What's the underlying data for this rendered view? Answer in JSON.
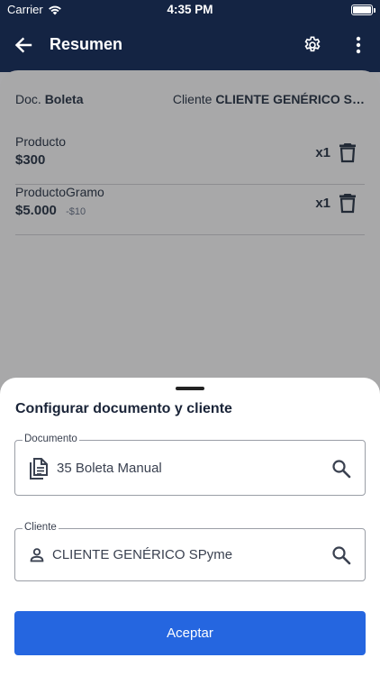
{
  "status_bar": {
    "carrier": "Carrier",
    "time": "4:35 PM",
    "battery_level": 1.0
  },
  "app_bar": {
    "title": "Resumen",
    "back_icon": "arrow-left-icon",
    "settings_icon": "gear-icon",
    "menu_icon": "more-vertical-icon"
  },
  "summary": {
    "doc_label": "Doc.",
    "doc_value": "Boleta",
    "client_label": "Cliente",
    "client_value": "CLIENTE GENÉRICO S…"
  },
  "products": [
    {
      "name": "Producto",
      "price": "$300",
      "discount": "",
      "qty": "x1"
    },
    {
      "name": "ProductoGramo",
      "price": "$5.000",
      "discount": "-$10",
      "qty": "x1"
    }
  ],
  "sheet": {
    "title": "Configurar documento y cliente",
    "document_field": {
      "label": "Documento",
      "value": "35 Boleta Manual",
      "icon": "document-icon"
    },
    "client_field": {
      "label": "Cliente",
      "value": "CLIENTE GENÉRICO SPyme",
      "icon": "person-icon"
    },
    "accept_label": "Aceptar"
  },
  "colors": {
    "app_bar": "#142443",
    "primary_button": "#2566e0",
    "sheet": "#ffffff",
    "scrim": "#a8a8a9"
  }
}
